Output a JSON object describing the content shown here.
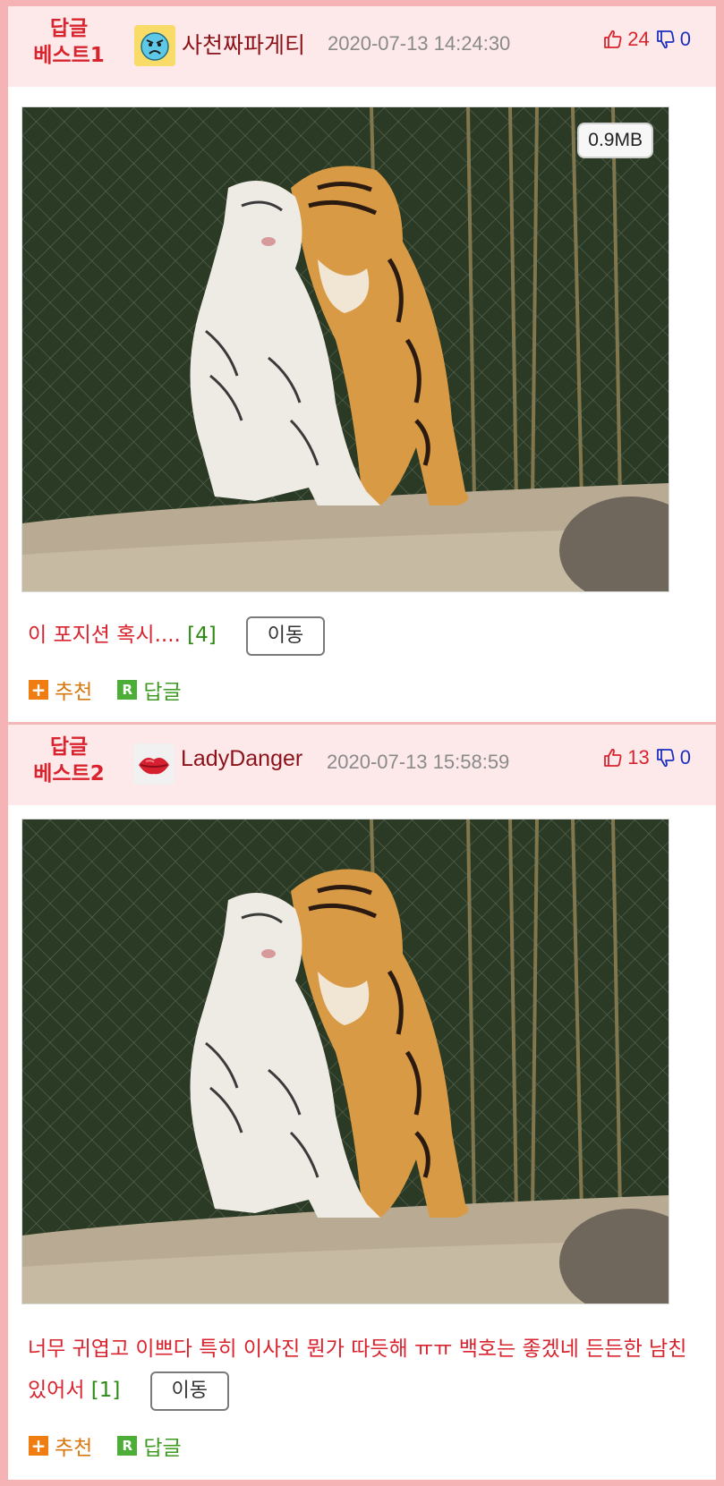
{
  "posts": [
    {
      "best_label_1": "답글",
      "best_label_2": "베스트1",
      "avatar_icon": "angry-face-emoji",
      "nickname": "사천짜파게티",
      "datetime": "2020-07-13 14:24:30",
      "likes": "24",
      "dislikes": "0",
      "image_alt": "white tiger and bengal tiger cuddling",
      "image_size": "0.9MB",
      "comment_text": "이 포지션 혹시....",
      "comment_count": "[4]",
      "move_button": "이동",
      "recommend_label": "추천",
      "reply_label": "답글"
    },
    {
      "best_label_1": "답글",
      "best_label_2": "베스트2",
      "avatar_icon": "lips-emoji",
      "nickname": "LadyDanger",
      "datetime": "2020-07-13 15:58:59",
      "likes": "13",
      "dislikes": "0",
      "image_alt": "white tiger and bengal tiger cuddling",
      "comment_text": "너무 귀엽고 이쁘다 특히 이사진 뭔가 따듯해 ㅠㅠ 백호는 좋겠네 든든한 남친 있어서",
      "comment_count": "[1]",
      "move_button": "이동",
      "recommend_label": "추천",
      "reply_label": "답글"
    }
  ],
  "colors": {
    "background": "#f6b3b6",
    "header_bg": "#fde9ea",
    "accent_red": "#d9232e",
    "nickname": "#8b1218",
    "date": "#8a8a8a",
    "dislike_blue": "#1a2fbf",
    "count_green": "#2d8a14",
    "recommend_orange": "#ef7d11",
    "reply_green": "#4cae36"
  }
}
